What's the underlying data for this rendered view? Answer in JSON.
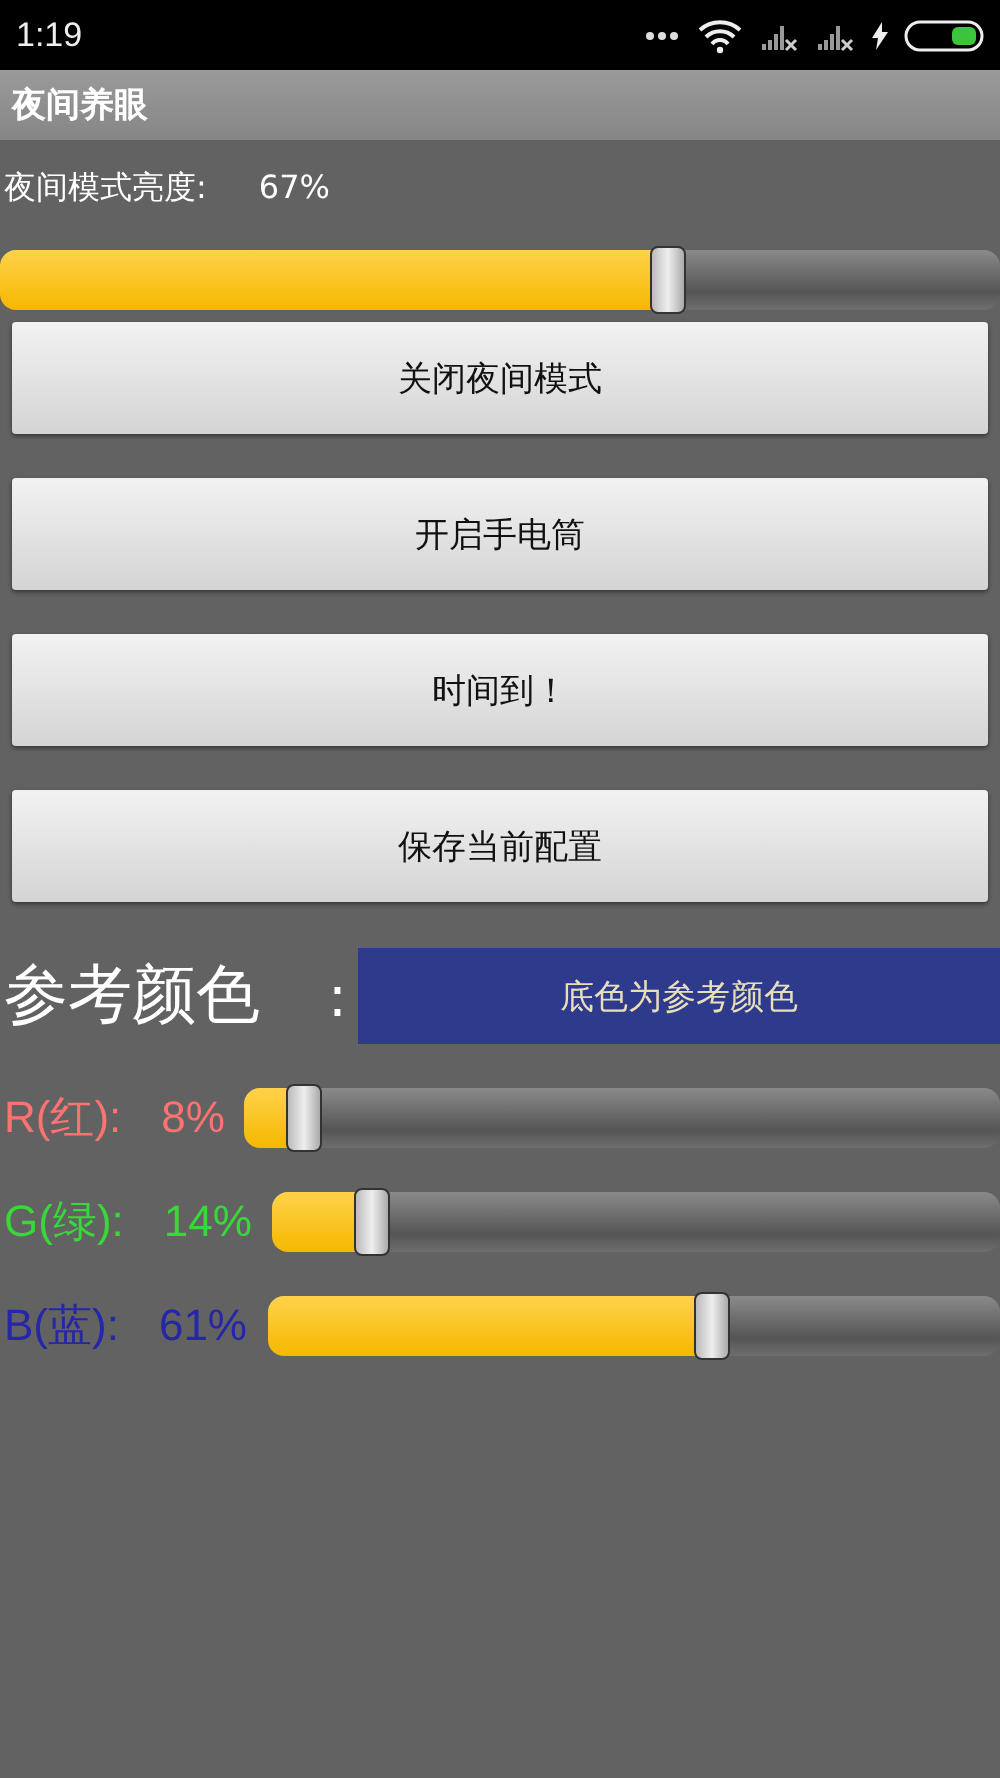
{
  "status_bar": {
    "time": "1:19"
  },
  "app_bar": {
    "title": "夜间养眼"
  },
  "brightness": {
    "label": "夜间模式亮度:",
    "reading": "67%",
    "level": 0.67
  },
  "buttons": [
    "关闭夜间模式",
    "开启手电筒",
    "时间到！",
    "保存当前配置"
  ],
  "reference": {
    "label": "参考颜色",
    "separator": ":",
    "swatch_text": "底色为参考颜色"
  },
  "channels": [
    {
      "name": "R(红):",
      "reading": "8%",
      "level": 0.08,
      "color": "#ff7272"
    },
    {
      "name": "G(绿):",
      "reading": "14%",
      "level": 0.14,
      "color": "#38d838"
    },
    {
      "name": "B(蓝):",
      "reading": "61%",
      "level": 0.61,
      "color": "#2626a8"
    }
  ]
}
